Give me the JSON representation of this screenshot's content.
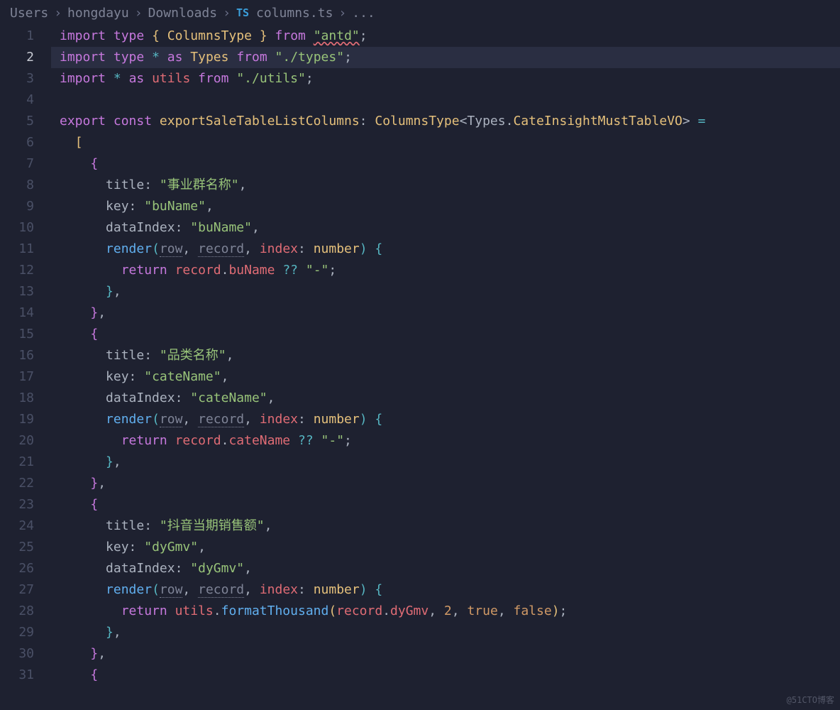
{
  "breadcrumbs": {
    "parts": [
      "Users",
      "hongdayu",
      "Downloads"
    ],
    "fileBadge": "TS",
    "file": "columns.ts",
    "trailing": "..."
  },
  "gutter": {
    "start": 1,
    "end": 31,
    "current": 2
  },
  "code": {
    "l1": {
      "kw1": "import",
      "kw2": "type",
      "brace_o": "{",
      "sym": "ColumnsType",
      "brace_c": "}",
      "kw3": "from",
      "str": "\"antd\"",
      "semi": ";"
    },
    "l2": {
      "kw1": "import",
      "kw2": "type",
      "star": "*",
      "kw3": "as",
      "alias": "Types",
      "kw4": "from",
      "str": "\"./types\"",
      "semi": ";"
    },
    "l3": {
      "kw1": "import",
      "star": "*",
      "kw2": "as",
      "alias": "utils",
      "kw3": "from",
      "str": "\"./utils\"",
      "semi": ";"
    },
    "l5": {
      "kw1": "export",
      "kw2": "const",
      "name": "exportSaleTableListColumns",
      "colon": ":",
      "type": "ColumnsType",
      "lt": "<",
      "ns": "Types",
      "dot": ".",
      "sub": "CateInsightMustTableVO",
      "gt": ">",
      "eq": "="
    },
    "l6": {
      "bracket": "["
    },
    "l7": {
      "brace": "{"
    },
    "l8": {
      "key": "title",
      "colon": ":",
      "val": "\"事业群名称\"",
      "comma": ","
    },
    "l9": {
      "key": "key",
      "colon": ":",
      "val": "\"buName\"",
      "comma": ","
    },
    "l10": {
      "key": "dataIndex",
      "colon": ":",
      "val": "\"buName\"",
      "comma": ","
    },
    "l11": {
      "fn": "render",
      "po": "(",
      "p1": "row",
      "c1": ",",
      "p2": "record",
      "c2": ",",
      "p3": "index",
      "colon": ":",
      "ptype": "number",
      "pc": ")",
      "brace": "{"
    },
    "l12": {
      "kw": "return",
      "obj": "record",
      "dot": ".",
      "prop": "buName",
      "op": "??",
      "str": "\"-\"",
      "semi": ";"
    },
    "l13": {
      "brace": "}",
      "comma": ","
    },
    "l14": {
      "brace": "}",
      "comma": ","
    },
    "l15": {
      "brace": "{"
    },
    "l16": {
      "key": "title",
      "colon": ":",
      "val": "\"品类名称\"",
      "comma": ","
    },
    "l17": {
      "key": "key",
      "colon": ":",
      "val": "\"cateName\"",
      "comma": ","
    },
    "l18": {
      "key": "dataIndex",
      "colon": ":",
      "val": "\"cateName\"",
      "comma": ","
    },
    "l19": {
      "fn": "render",
      "po": "(",
      "p1": "row",
      "c1": ",",
      "p2": "record",
      "c2": ",",
      "p3": "index",
      "colon": ":",
      "ptype": "number",
      "pc": ")",
      "brace": "{"
    },
    "l20": {
      "kw": "return",
      "obj": "record",
      "dot": ".",
      "prop": "cateName",
      "op": "??",
      "str": "\"-\"",
      "semi": ";"
    },
    "l21": {
      "brace": "}",
      "comma": ","
    },
    "l22": {
      "brace": "}",
      "comma": ","
    },
    "l23": {
      "brace": "{"
    },
    "l24": {
      "key": "title",
      "colon": ":",
      "val": "\"抖音当期销售额\"",
      "comma": ","
    },
    "l25": {
      "key": "key",
      "colon": ":",
      "val": "\"dyGmv\"",
      "comma": ","
    },
    "l26": {
      "key": "dataIndex",
      "colon": ":",
      "val": "\"dyGmv\"",
      "comma": ","
    },
    "l27": {
      "fn": "render",
      "po": "(",
      "p1": "row",
      "c1": ",",
      "p2": "record",
      "c2": ",",
      "p3": "index",
      "colon": ":",
      "ptype": "number",
      "pc": ")",
      "brace": "{"
    },
    "l28": {
      "kw": "return",
      "obj": "utils",
      "dot": ".",
      "fn": "formatThousand",
      "po": "(",
      "a1": "record",
      "dot2": ".",
      "prop": "dyGmv",
      "c1": ",",
      "n": "2",
      "c2": ",",
      "b1": "true",
      "c3": ",",
      "b2": "false",
      "pc": ")",
      "semi": ";"
    },
    "l29": {
      "brace": "}",
      "comma": ","
    },
    "l30": {
      "brace": "}",
      "comma": ","
    },
    "l31": {
      "brace": "{"
    }
  },
  "watermark": "@51CTO博客"
}
